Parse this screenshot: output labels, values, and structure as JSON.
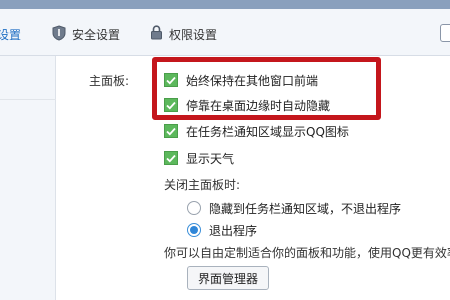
{
  "tabs": [
    {
      "label": "设置",
      "icon": "partial-tab"
    },
    {
      "label": "安全设置",
      "icon": "shield-icon"
    },
    {
      "label": "权限设置",
      "icon": "lock-icon"
    }
  ],
  "panel": {
    "section_label": "主面板:",
    "options": [
      {
        "label": "始终保持在其他窗口前端",
        "checked": true
      },
      {
        "label": "停靠在桌面边缘时自动隐藏",
        "checked": true
      },
      {
        "label": "在任务栏通知区域显示QQ图标",
        "checked": true
      },
      {
        "label": "显示天气",
        "checked": true
      }
    ],
    "close_heading": "关闭主面板时:",
    "close_options": [
      {
        "label": "隐藏到任务栏通知区域，不退出程序",
        "selected": false
      },
      {
        "label": "退出程序",
        "selected": true
      }
    ],
    "hint": "你可以自由定制适合你的面板和功能，使用QQ更有效率",
    "manager_button": "界面管理器"
  },
  "colors": {
    "highlight": "#c4161c",
    "checkbox": "#5cb85c",
    "radio_selected": "#2f86d8",
    "active_tab": "#1f6fc4"
  }
}
